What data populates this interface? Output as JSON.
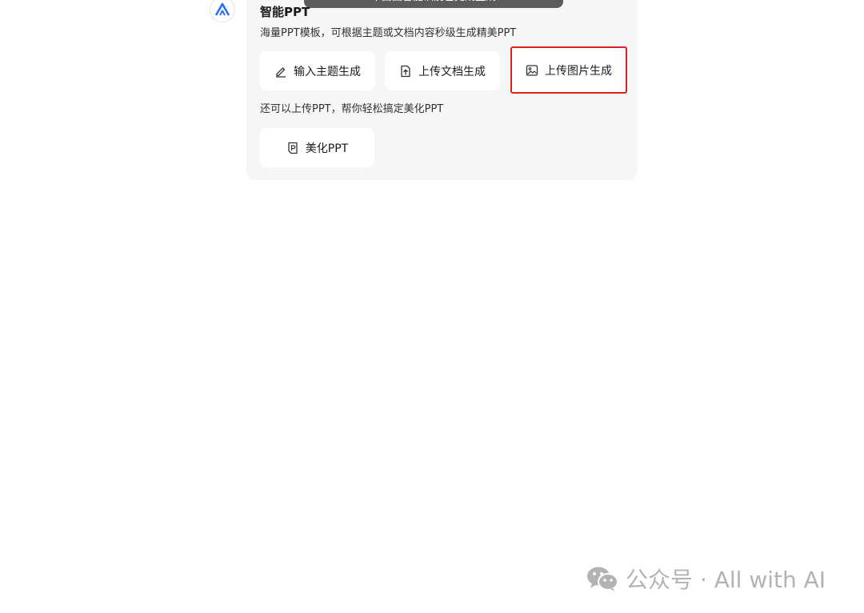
{
  "card": {
    "toast_text": "平面图智能识别已完成生成",
    "title": "智能PPT",
    "description": "海量PPT模板，可根据主题或文档内容秒级生成精美PPT",
    "buttons": [
      {
        "label": "输入主题生成",
        "icon": "pen-icon"
      },
      {
        "label": "上传文档生成",
        "icon": "upload-file-icon"
      },
      {
        "label": "上传图片生成",
        "icon": "image-icon"
      }
    ],
    "beautify_description": "还可以上传PPT，帮你轻松搞定美化PPT",
    "beautify_button": {
      "label": "美化PPT",
      "icon": "ppt-file-icon"
    }
  },
  "watermark": {
    "text": "公众号 · All with AI",
    "icon": "wechat-icon"
  },
  "colors": {
    "card_bg": "#f5f6f8",
    "highlight_border": "#e02020",
    "logo_blue": "#2b6ef5"
  }
}
